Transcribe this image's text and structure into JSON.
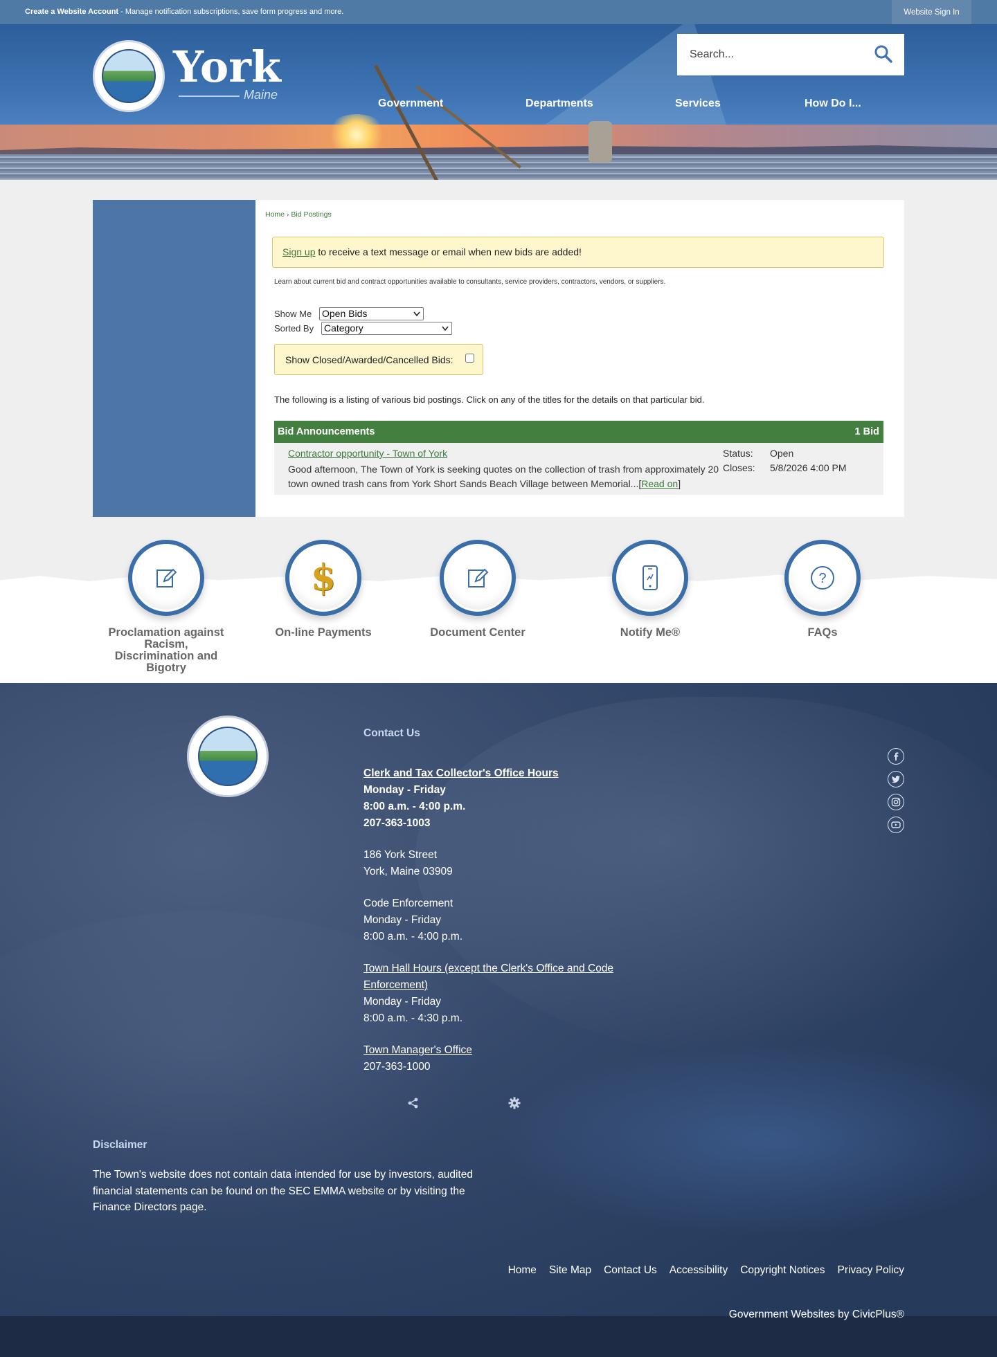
{
  "topbar": {
    "account_link": "Create a Website Account",
    "account_desc": " - Manage notification subscriptions, save form progress and more.",
    "signin": "Website Sign In"
  },
  "header": {
    "logo_word": "York",
    "logo_sub": "Maine",
    "search_placeholder": "Search...",
    "nav": [
      "Government",
      "Departments",
      "Services",
      "How Do I..."
    ]
  },
  "breadcrumb": {
    "home": "Home",
    "sep": " › ",
    "current": "Bid Postings"
  },
  "notice": {
    "link": "Sign up",
    "text": " to receive a text message or email when new bids are added!"
  },
  "intro": "Learn about current bid and contract opportunities available to consultants, service providers, contractors, vendors, or suppliers.",
  "filters": {
    "show_me_label": "Show Me",
    "show_me_value": "Open Bids",
    "sorted_by_label": "Sorted By",
    "sorted_by_value": "Category",
    "closed_label": "Show Closed/Awarded/Cancelled Bids:"
  },
  "listing_note": "The following is a listing of various bid postings. Click on any of the titles for the details on that particular bid.",
  "bids": {
    "header": "Bid Announcements",
    "count": "1 Bid",
    "items": [
      {
        "title": "Contractor opportunity - Town of York",
        "description": "Good afternoon, The Town of York is seeking quotes on the collection of trash from approximately 20 town owned trash cans from York Short Sands Beach Village between Memorial...",
        "read_on_open": "[",
        "read_on": "Read on",
        "read_on_close": "]",
        "status_label": "Status:",
        "status": "Open",
        "closes_label": "Closes:",
        "closes": "5/8/2026 4:00 PM"
      }
    ]
  },
  "quick_links": [
    {
      "label": "Proclamation against Racism, Discrimination and Bigotry",
      "icon": "edit-document-icon"
    },
    {
      "label": "On-line Payments",
      "icon": "dollar-icon"
    },
    {
      "label": "Document Center",
      "icon": "edit-document-icon"
    },
    {
      "label": "Notify Me®",
      "icon": "mobile-phone-icon"
    },
    {
      "label": "FAQs",
      "icon": "question-icon"
    }
  ],
  "footer": {
    "contact_heading": "Contact Us",
    "clerk_link": "Clerk and Tax Collector's Office Hours",
    "clerk_days": "Monday - Friday",
    "clerk_hours": "8:00 a.m. - 4:00 p.m.",
    "clerk_phone": "207-363-1003",
    "address1": "186 York Street",
    "address2": "York, Maine 03909",
    "code_title": "Code Enforcement",
    "code_days": "Monday - Friday",
    "code_hours": "8:00 a.m. - 4:00 p.m.",
    "townhall_link": "Town Hall Hours (except the Clerk's Office and Code Enforcement)",
    "townhall_days": "Monday - Friday",
    "townhall_hours": "8:00 a.m. - 4:30 p.m.",
    "manager_link": "Town Manager's Office",
    "manager_phone": "207-363-1000",
    "social": [
      "facebook-icon",
      "twitter-icon",
      "instagram-icon",
      "youtube-icon"
    ],
    "disclaimer_heading": "Disclaimer",
    "disclaimer_text": "The Town's website does not contain data intended for use by investors, audited financial statements can be found on the SEC EMMA website or by visiting the Finance Directors page.",
    "links": [
      "Home",
      "Site Map",
      "Contact Us",
      "Accessibility",
      "Copyright Notices",
      "Privacy Policy"
    ],
    "credit": "Government Websites by CivicPlus®"
  },
  "colors": {
    "brand_blue": "#4f7aa5",
    "accent_green": "#43803f",
    "notice_yellow": "#fef6cc"
  }
}
